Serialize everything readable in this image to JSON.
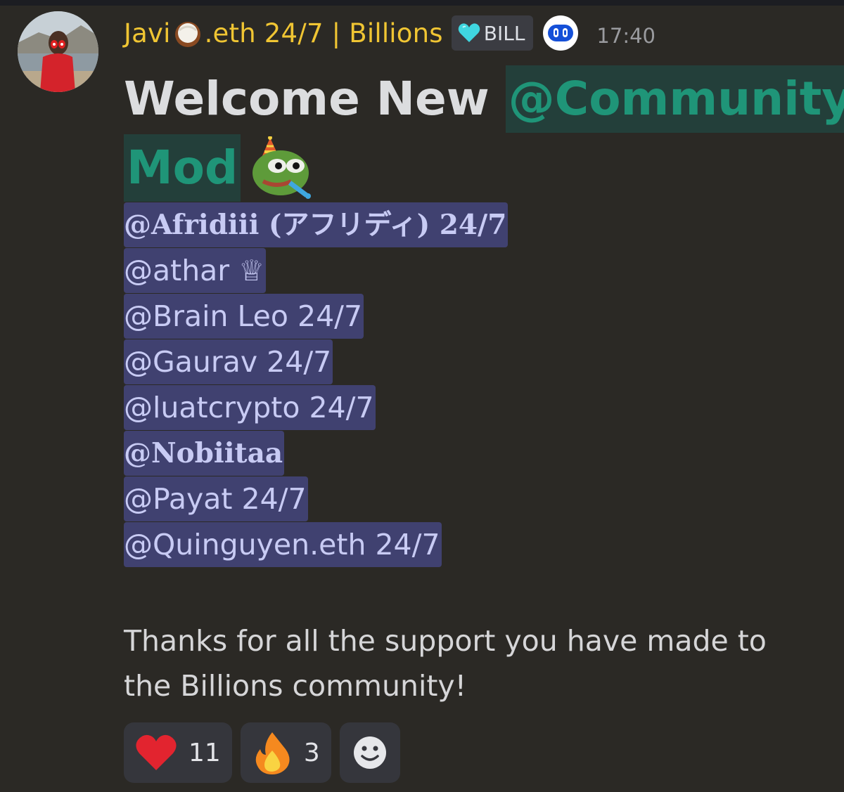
{
  "message": {
    "author": {
      "name_part1": "Javi",
      "name_part2": ".eth 24/7 | Billions",
      "name_color": "#f0c533"
    },
    "tag_badge": {
      "icon": "cyan-heart-icon",
      "label": "BILL"
    },
    "bot_badge_icon": "robot-face-icon",
    "timestamp": "17:40",
    "headline": {
      "text": "Welcome New",
      "role_mention_part1": "@Community",
      "role_mention_part2": "Mod",
      "emoji": "party-pepe-emoji"
    },
    "mentions": [
      "@Afridiii (アフリディ) 24/7",
      "@athar ♕",
      "@Brain Leo 24/7",
      "@Gaurav 24/7",
      "@luatcrypto 24/7",
      "@Nobiitaa",
      "@Payat 24/7",
      "@Quinguyen.eth 24/7"
    ],
    "body_text": "Thanks for all the support you have made to the Billions community!"
  },
  "reactions": [
    {
      "emoji": "red-heart-emoji",
      "count": "11"
    },
    {
      "emoji": "fire-emoji",
      "count": "3"
    }
  ],
  "add_reaction_icon": "smiley-add-reaction-icon",
  "colors": {
    "background": "#2b2925",
    "role_mention_bg": "#233f3a",
    "role_mention_text": "#1f9578",
    "user_mention_bg": "#404170",
    "user_mention_text": "#c8cbf4"
  }
}
